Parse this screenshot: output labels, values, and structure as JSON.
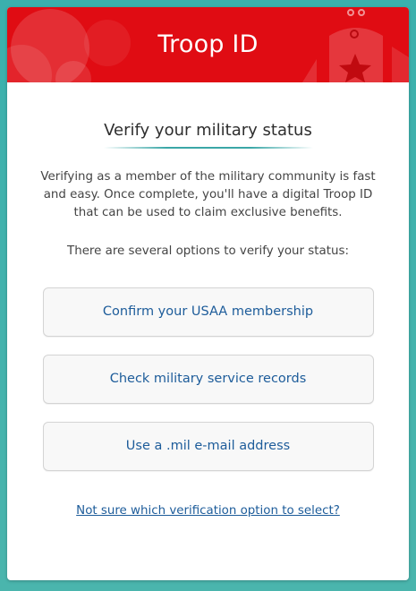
{
  "header": {
    "title": "Troop ID",
    "background_color": "#e00c13"
  },
  "main": {
    "title": "Verify your military status",
    "intro": "Verifying as a member of the military community is fast and easy. Once complete, you'll have a digital Troop ID that can be used to claim exclusive benefits.",
    "options_lead": "There are several options to verify your status:",
    "options": [
      {
        "label": "Confirm your USAA membership"
      },
      {
        "label": "Check military service records"
      },
      {
        "label": "Use a .mil e-mail address"
      }
    ],
    "help_link": "Not sure which verification option to select?"
  },
  "colors": {
    "page_background": "#3bb0ad",
    "link": "#1d5c9a",
    "accent_underline": "#3aa7a7"
  }
}
